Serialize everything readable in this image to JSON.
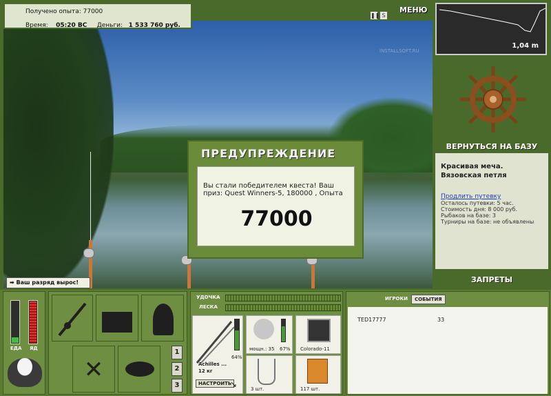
{
  "top": {
    "exp_label": "Получено опыта:",
    "exp_value": "77000",
    "time_label": "Время:",
    "time_value": "05:20 ВС",
    "money_label": "Деньги:",
    "money_value": "1 533 760 руб.",
    "pause_icon": "pause-icon",
    "sound_icon": "S",
    "menu_label": "МЕНЮ",
    "watermark": "INSTALLSOFT.RU"
  },
  "depth": {
    "value": "1,04 m"
  },
  "right": {
    "return_label": "ВЕРНУТЬСЯ НА БАЗУ",
    "base_name_1": "Красивая меча.",
    "base_name_2": "Вязовская петля",
    "extend_link": "Продлить путевку",
    "info": [
      "Осталось путевки: 5 час.",
      "Стоимость дня: 8 000 руб.",
      "Рыбаков на базе: 3",
      "Турниры на базе: не объявлены"
    ],
    "bans_label": "ЗАПРЕТЫ"
  },
  "dialog": {
    "title": "ПРЕДУПРЕЖДЕНИЕ",
    "text": "Вы стали победителем квеста! Ваш приз: Quest Winners-5, 180000 , Опыта",
    "number": "77000"
  },
  "notice": "Ваш разряд вырос!",
  "bottom": {
    "food_label": "ЕДА",
    "poison_label": "ЯД",
    "rod_label": "УДОЧКА",
    "line_label": "ЛЕСКА",
    "pages": [
      "1",
      "2",
      "3"
    ],
    "rod_name": "Achilles ...",
    "rod_weight": "12 кг",
    "rod_percent": "64%",
    "setup_label": "НАСТРОИТЬ",
    "reel_label": "мощн.: 35",
    "reel_percent": "67%",
    "line_item": "Colorado-11",
    "hooks_count": "3 шт.",
    "bait_count": "117 шт.",
    "tab_players": "ИГРОКИ",
    "tab_events": "СОБЫТИЯ",
    "players": [
      {
        "name": "TED17777",
        "value": "33"
      }
    ]
  },
  "colors": {
    "accent": "#4a6a2c",
    "panel": "#dfe3d0",
    "link": "#1a3fbf"
  }
}
